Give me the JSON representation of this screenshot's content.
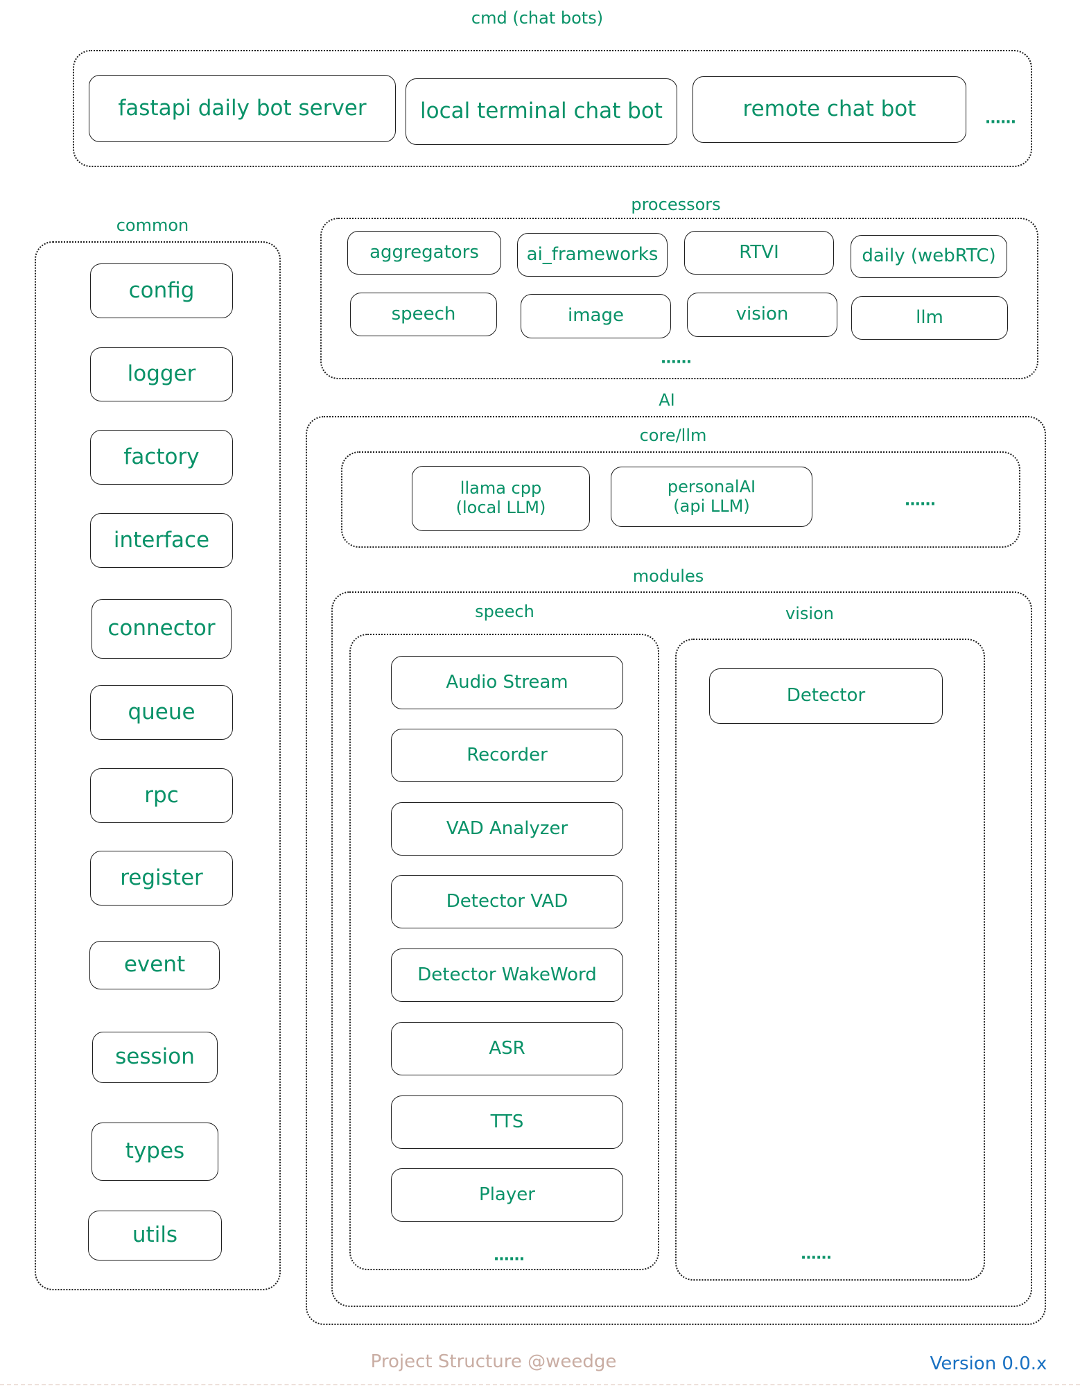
{
  "title": "cmd (chat bots)",
  "cmd": {
    "label": "cmd (chat bots)",
    "items": [
      "fastapi daily bot server",
      "local terminal chat bot",
      "remote chat bot"
    ],
    "more": "......"
  },
  "common": {
    "label": "common",
    "items": [
      "config",
      "logger",
      "factory",
      "interface",
      "connector",
      "queue",
      "rpc",
      "register",
      "event",
      "session",
      "types",
      "utils"
    ]
  },
  "processors": {
    "label": "processors",
    "items": [
      "aggregators",
      "ai_frameworks",
      "RTVI",
      "daily (webRTC)",
      "speech",
      "image",
      "vision",
      "llm"
    ],
    "more": "......"
  },
  "ai": {
    "label": "AI",
    "core_llm": {
      "label": "core/llm",
      "items": [
        "llama cpp\n(local LLM)",
        "personalAI\n(api LLM)"
      ],
      "more": "......"
    },
    "modules": {
      "label": "modules",
      "speech": {
        "label": "speech",
        "items": [
          "Audio Stream",
          "Recorder",
          "VAD Analyzer",
          "Detector VAD",
          "Detector WakeWord",
          "ASR",
          "TTS",
          "Player"
        ],
        "more": "......"
      },
      "vision": {
        "label": "vision",
        "items": [
          "Detector"
        ],
        "more": "......"
      }
    }
  },
  "footer": {
    "credit": "Project Structure @weedge",
    "version": "Version 0.0.x"
  },
  "colors": {
    "text_green": "#099268",
    "stroke": "#1e1e1e",
    "credit": "#c9ada3",
    "version_blue": "#1971c2"
  }
}
